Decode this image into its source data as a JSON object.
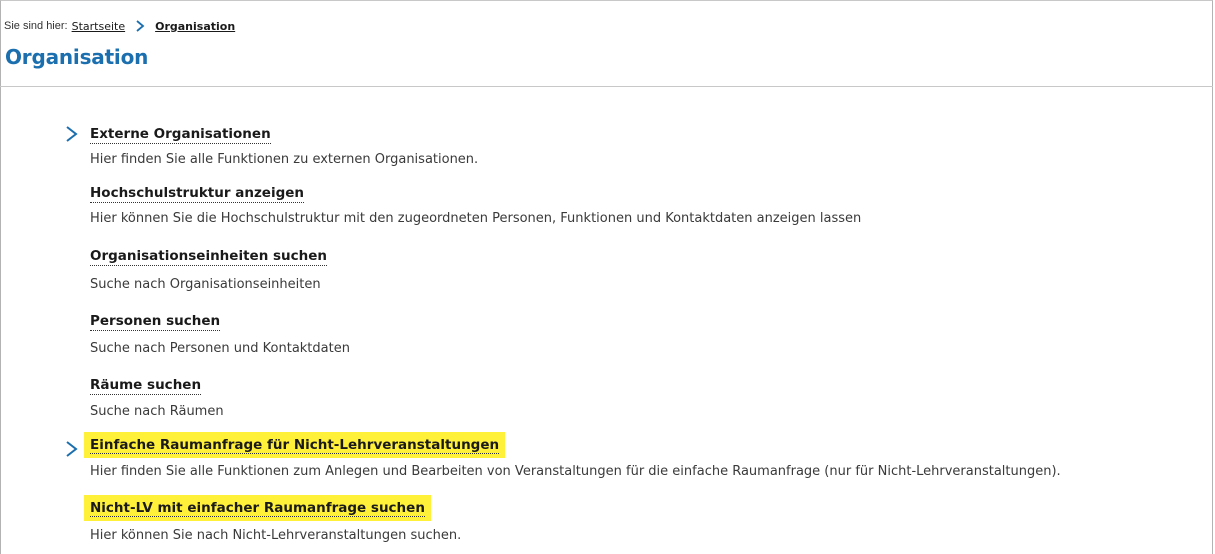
{
  "breadcrumb": {
    "prefix": "Sie sind hier:",
    "items": [
      {
        "label": "Startseite"
      },
      {
        "label": "Organisation"
      }
    ]
  },
  "page": {
    "title": "Organisation"
  },
  "menu": [
    {
      "label": "Externe Organisationen",
      "description": "Hier finden Sie alle Funktionen zu externen Organisationen.",
      "has_arrow": true,
      "highlighted": false
    },
    {
      "label": "Hochschulstruktur anzeigen",
      "description": "Hier können Sie die Hochschulstruktur mit den zugeordneten Personen, Funktionen und Kontaktdaten anzeigen lassen",
      "has_arrow": false,
      "highlighted": false
    },
    {
      "label": "Organisationseinheiten suchen",
      "description": "Suche nach Organisationseinheiten",
      "has_arrow": false,
      "highlighted": false
    },
    {
      "label": "Personen suchen",
      "description": "Suche nach Personen und Kontaktdaten",
      "has_arrow": false,
      "highlighted": false
    },
    {
      "label": "Räume suchen",
      "description": "Suche nach Räumen",
      "has_arrow": false,
      "highlighted": false
    },
    {
      "label": "Einfache Raumanfrage für Nicht-Lehrveranstaltungen",
      "description": "Hier finden Sie alle Funktionen zum Anlegen und Bearbeiten von Veranstaltungen für die einfache Raumanfrage (nur für Nicht-Lehrveranstaltungen).",
      "has_arrow": true,
      "highlighted": true
    },
    {
      "label": "Nicht-LV mit einfacher Raumanfrage suchen",
      "description": "Hier können Sie nach Nicht-Lehrveranstaltungen suchen.",
      "has_arrow": false,
      "highlighted": true
    }
  ],
  "icons": {
    "breadcrumb_separator": "chevron-right-icon",
    "submenu_arrow": "chevron-right-icon"
  },
  "colors": {
    "title": "#1b6fae",
    "arrow": "#1b6fae",
    "highlight": "#fff03a",
    "text": "#1a1a1a",
    "description": "#3a3a3a"
  }
}
